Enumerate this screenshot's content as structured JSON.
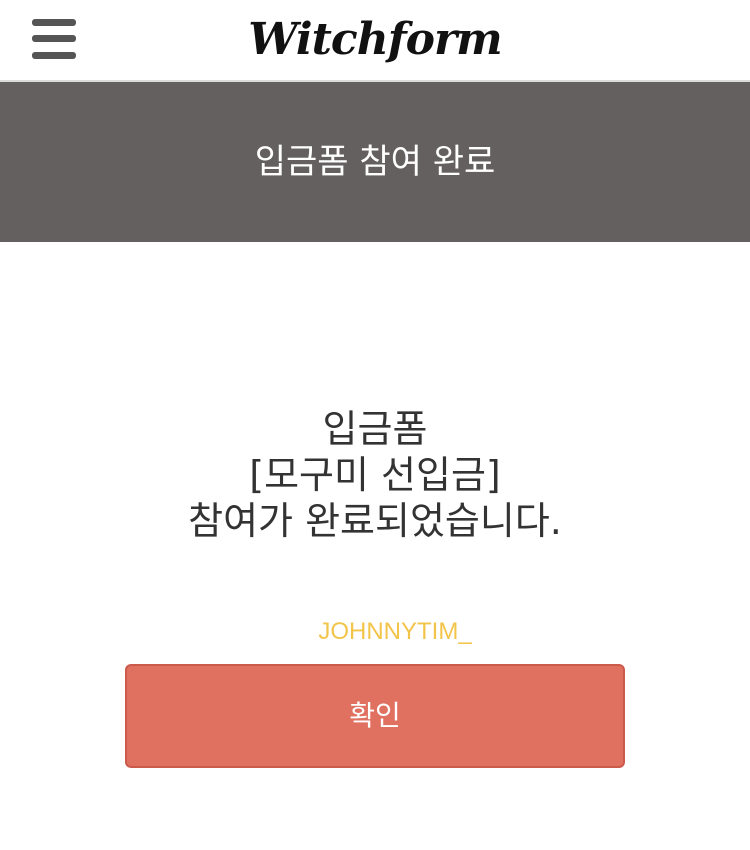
{
  "header": {
    "logo_text": "Witchform",
    "menu_icon": "hamburger-menu-icon"
  },
  "banner": {
    "title": "입금폼 참여 완료"
  },
  "message": {
    "line1": "입금폼",
    "line2": "[모구미 선입금]",
    "line3": "참여가 완료되었습니다."
  },
  "user": {
    "name": "JOHNNYTIM_"
  },
  "confirm_button": {
    "label": "확인"
  },
  "colors": {
    "banner_bg": "#656060",
    "button_bg": "#e07060",
    "username": "#f2c44a"
  }
}
